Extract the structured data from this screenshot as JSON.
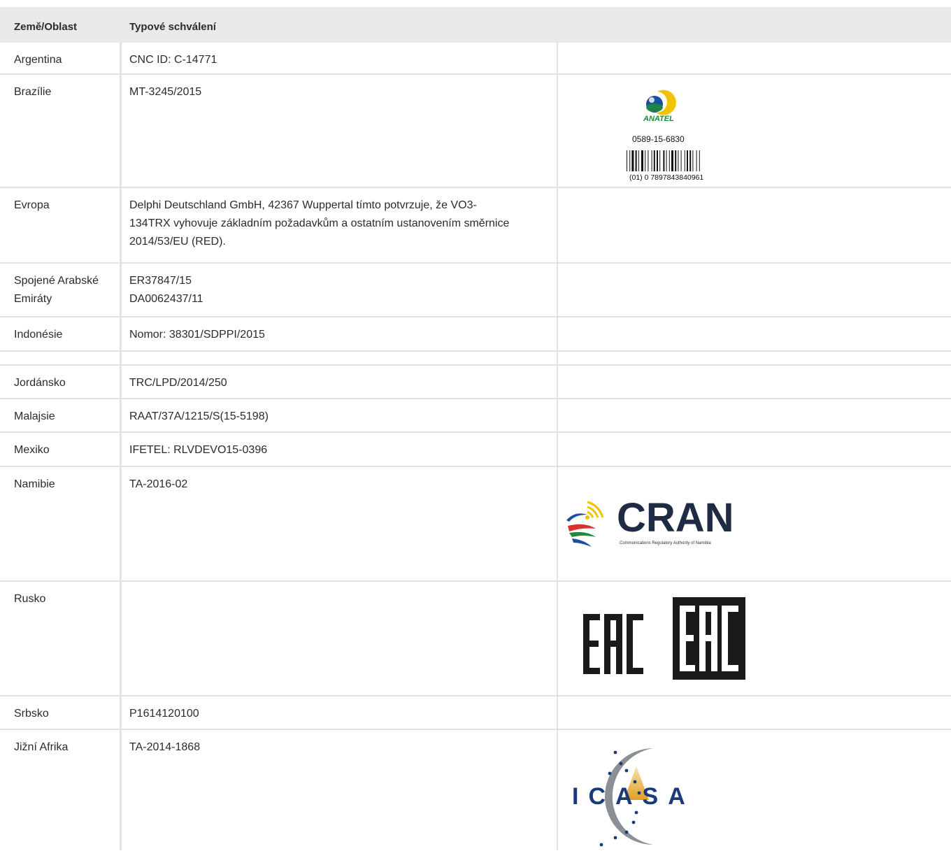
{
  "table": {
    "headers": [
      "Země/Oblast",
      "Typové schválení"
    ],
    "rows": [
      {
        "country": "Argentina",
        "approval": [
          "CNC ID: C-14771"
        ]
      },
      {
        "country": "Brazílie",
        "approval": [
          "MT-3245/2015"
        ],
        "logo": "anatel",
        "logo_text": {
          "brand": "ANATEL",
          "code": "0589-15-6830",
          "barcode": "(01) 0 7897843840961"
        }
      },
      {
        "country": "Evropa",
        "approval": [
          "Delphi Deutschland GmbH, 42367 Wuppertal tímto potvrzuje, že VO3-",
          "134TRX vyhovuje základním požadavkům a ostatním ustanovením směrnice",
          "2014/53/EU (RED)."
        ]
      },
      {
        "country": "Spojené Arabské Emiráty",
        "country_lines": [
          "Spojené Arabské",
          "Emiráty"
        ],
        "approval": [
          "ER37847/15",
          "DA0062437/11"
        ]
      },
      {
        "country": "Indonésie",
        "approval": [
          "Nomor: 38301/SDPPI/2015"
        ]
      },
      {
        "country": "",
        "approval": []
      },
      {
        "country": "Jordánsko",
        "approval": [
          "TRC/LPD/2014/250"
        ]
      },
      {
        "country": "Malajsie",
        "approval": [
          "RAAT/37A/1215/S(15-5198)"
        ]
      },
      {
        "country": "Mexiko",
        "approval": [
          "IFETEL: RLVDEVO15-0396"
        ]
      },
      {
        "country": "Namibie",
        "approval": [
          "TA-2016-02"
        ],
        "logo": "cran",
        "logo_text": {
          "brand": "CRAN",
          "tagline": "Communications Regulatory Authority of Namibia"
        }
      },
      {
        "country": "Rusko",
        "approval": [],
        "logo": "eac",
        "logo_text": {
          "mark": "EAC"
        }
      },
      {
        "country": "Srbsko",
        "approval": [
          "P1614120100"
        ]
      },
      {
        "country": "Jižní Afrika",
        "approval": [
          "TA-2014-1868"
        ],
        "logo": "icasa",
        "logo_text": {
          "brand": "ICASA"
        }
      }
    ]
  },
  "colors": {
    "header_bg": "#e9e9e9",
    "grid": "#e2e2e2",
    "anatel_blue": "#1b4fa0",
    "anatel_green": "#1e8a3a",
    "anatel_yellow": "#f2c200",
    "cran_navy": "#1f2a44"
  }
}
